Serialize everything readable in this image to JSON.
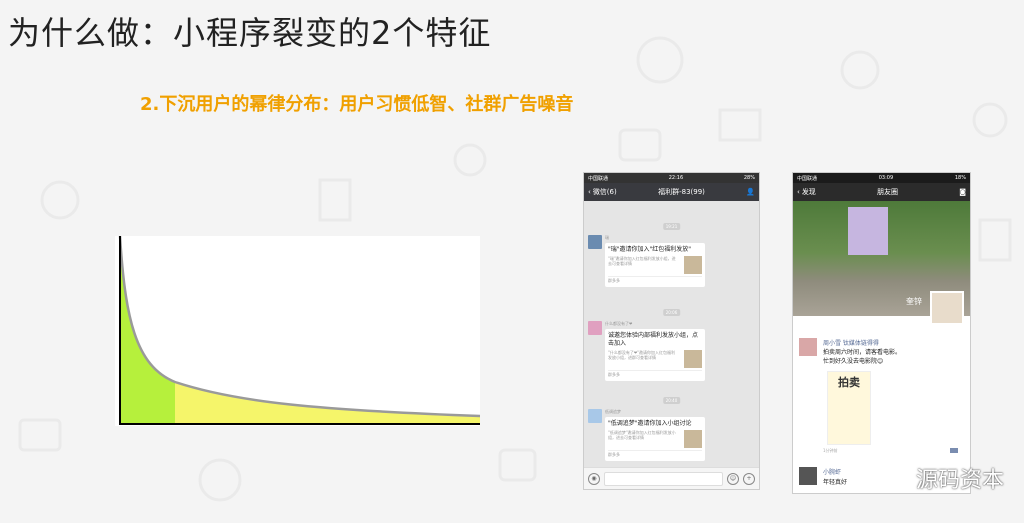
{
  "slide": {
    "title": "为什么做：小程序裂变的2个特征",
    "subtitle": "2.下沉用户的幂律分布：用户习惯低智、社群广告噪音"
  },
  "colors": {
    "accent": "#f0a000",
    "head_fill": "#b6f03c",
    "tail_fill": "#f5f56a",
    "curve": "#999999"
  },
  "phone1": {
    "status_carrier": "中国联通",
    "status_time": "22:16",
    "status_battery": "28%",
    "nav_back": "微信(6)",
    "nav_title": "福利群-83(99)",
    "messages": [
      {
        "time": "19:21",
        "sender": "瑞",
        "card_title": "\"瑞\"邀请你加入\"红包福利发放\"",
        "card_desc": "\"瑞\"邀请你加入红包福利发放小组，进去可查看详情",
        "card_foot": "群多多"
      },
      {
        "time": "20:06",
        "sender": "什么都没有了❤",
        "card_title": "诚邀您体验内部福利发放小组，点击加入",
        "card_desc": "\"什么都没有了❤\"邀请你加入红包福利发放小组，进群可查看详情",
        "card_foot": "群多多"
      },
      {
        "time": "20:40",
        "sender": "低调追梦",
        "card_title": "\"低调追梦\"邀请你加入小组讨论",
        "card_desc": "\"低调追梦\"邀请你加入红包福利发放小组，进去可查看详情",
        "card_foot": "群多多"
      }
    ]
  },
  "phone2": {
    "status_carrier": "中国联通",
    "status_time": "03:09",
    "status_battery": "18%",
    "nav_back": "发现",
    "nav_title": "朋友圈",
    "cover_name": "奎锌",
    "post_name": "周小雪 钛媒体链得得",
    "post_text_1": "拍卖周六时间，请客看电影。",
    "post_text_2": "忙到好久没去电影院😊",
    "post_image_text": "拍卖",
    "post_time": "1分钟前",
    "post2_name": "小腕虾",
    "post2_text": "年轻真好"
  },
  "watermark": {
    "text": "源码资本"
  }
}
